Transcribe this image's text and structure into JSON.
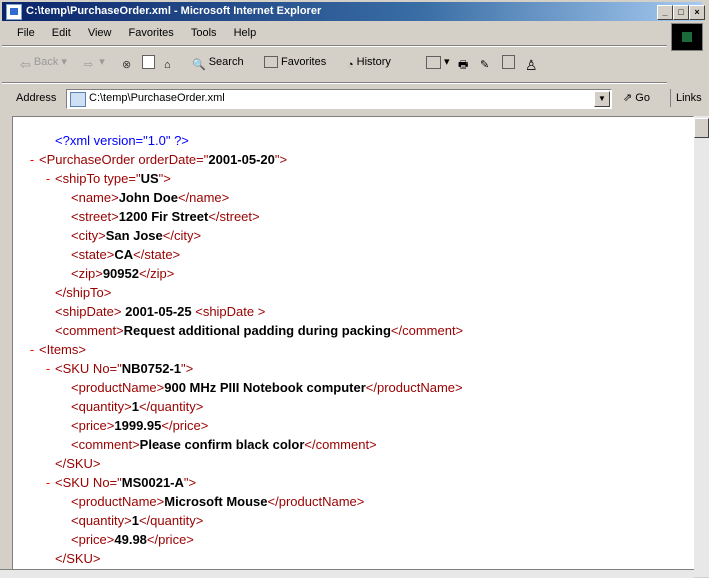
{
  "window": {
    "title": "C:\\temp\\PurchaseOrder.xml - Microsoft Internet Explorer"
  },
  "menu": [
    "File",
    "Edit",
    "View",
    "Favorites",
    "Tools",
    "Help"
  ],
  "toolbar": {
    "back": "Back",
    "search": "Search",
    "favorites": "Favorites",
    "history": "History"
  },
  "address": {
    "label": "Address",
    "value": "C:\\temp\\PurchaseOrder.xml",
    "go": "Go",
    "links": "Links"
  },
  "xml": [
    {
      "mark": "",
      "tag": "<?xml version=\"1.0\" ?>",
      "kind": "pi"
    },
    {
      "mark": "-",
      "open": "<PurchaseOrder orderDate=\"",
      "val": "2001-05-20",
      "close": "\">"
    },
    {
      "mark": "-",
      "open": "<shipTo type=\"",
      "val": "US",
      "close": "\">"
    },
    {
      "mark": "",
      "open": "<name>",
      "val": "John Doe",
      "close": "</name>"
    },
    {
      "mark": "",
      "open": "<street>",
      "val": "1200 Fir Street",
      "close": "</street>"
    },
    {
      "mark": "",
      "open": "<city>",
      "val": "San Jose",
      "close": "</city>"
    },
    {
      "mark": "",
      "open": "<state>",
      "val": "CA",
      "close": "</state>"
    },
    {
      "mark": "",
      "open": "<zip>",
      "val": "90952",
      "close": "</zip>"
    },
    {
      "mark": "",
      "open": "</shipTo>",
      "val": "",
      "close": ""
    },
    {
      "mark": "",
      "open": "<shipDate> ",
      "val": "2001-05-25",
      "close": " <shipDate >"
    },
    {
      "mark": "",
      "open": "<comment>",
      "val": "Request additional padding during packing",
      "close": "</comment>"
    },
    {
      "mark": "-",
      "open": "<Items>",
      "val": "",
      "close": ""
    },
    {
      "mark": "-",
      "open": "<SKU No=\"",
      "val": "NB0752-1",
      "close": "\">"
    },
    {
      "mark": "",
      "open": "<productName>",
      "val": "900 MHz PIII Notebook computer",
      "close": "</productName>"
    },
    {
      "mark": "",
      "open": "<quantity>",
      "val": "1",
      "close": "</quantity>"
    },
    {
      "mark": "",
      "open": "<price>",
      "val": "1999.95",
      "close": "</price>"
    },
    {
      "mark": "",
      "open": "<comment>",
      "val": "Please confirm black color",
      "close": "</comment>"
    },
    {
      "mark": "",
      "open": "</SKU>",
      "val": "",
      "close": ""
    },
    {
      "mark": "-",
      "open": "<SKU No=\"",
      "val": "MS0021-A",
      "close": "\">"
    },
    {
      "mark": "",
      "open": "<productName>",
      "val": "Microsoft Mouse",
      "close": "</productName>"
    },
    {
      "mark": "",
      "open": "<quantity>",
      "val": "1",
      "close": "</quantity>"
    },
    {
      "mark": "",
      "open": "<price>",
      "val": "49.98",
      "close": "</price>"
    },
    {
      "mark": "",
      "open": "</SKU>",
      "val": "",
      "close": ""
    }
  ]
}
